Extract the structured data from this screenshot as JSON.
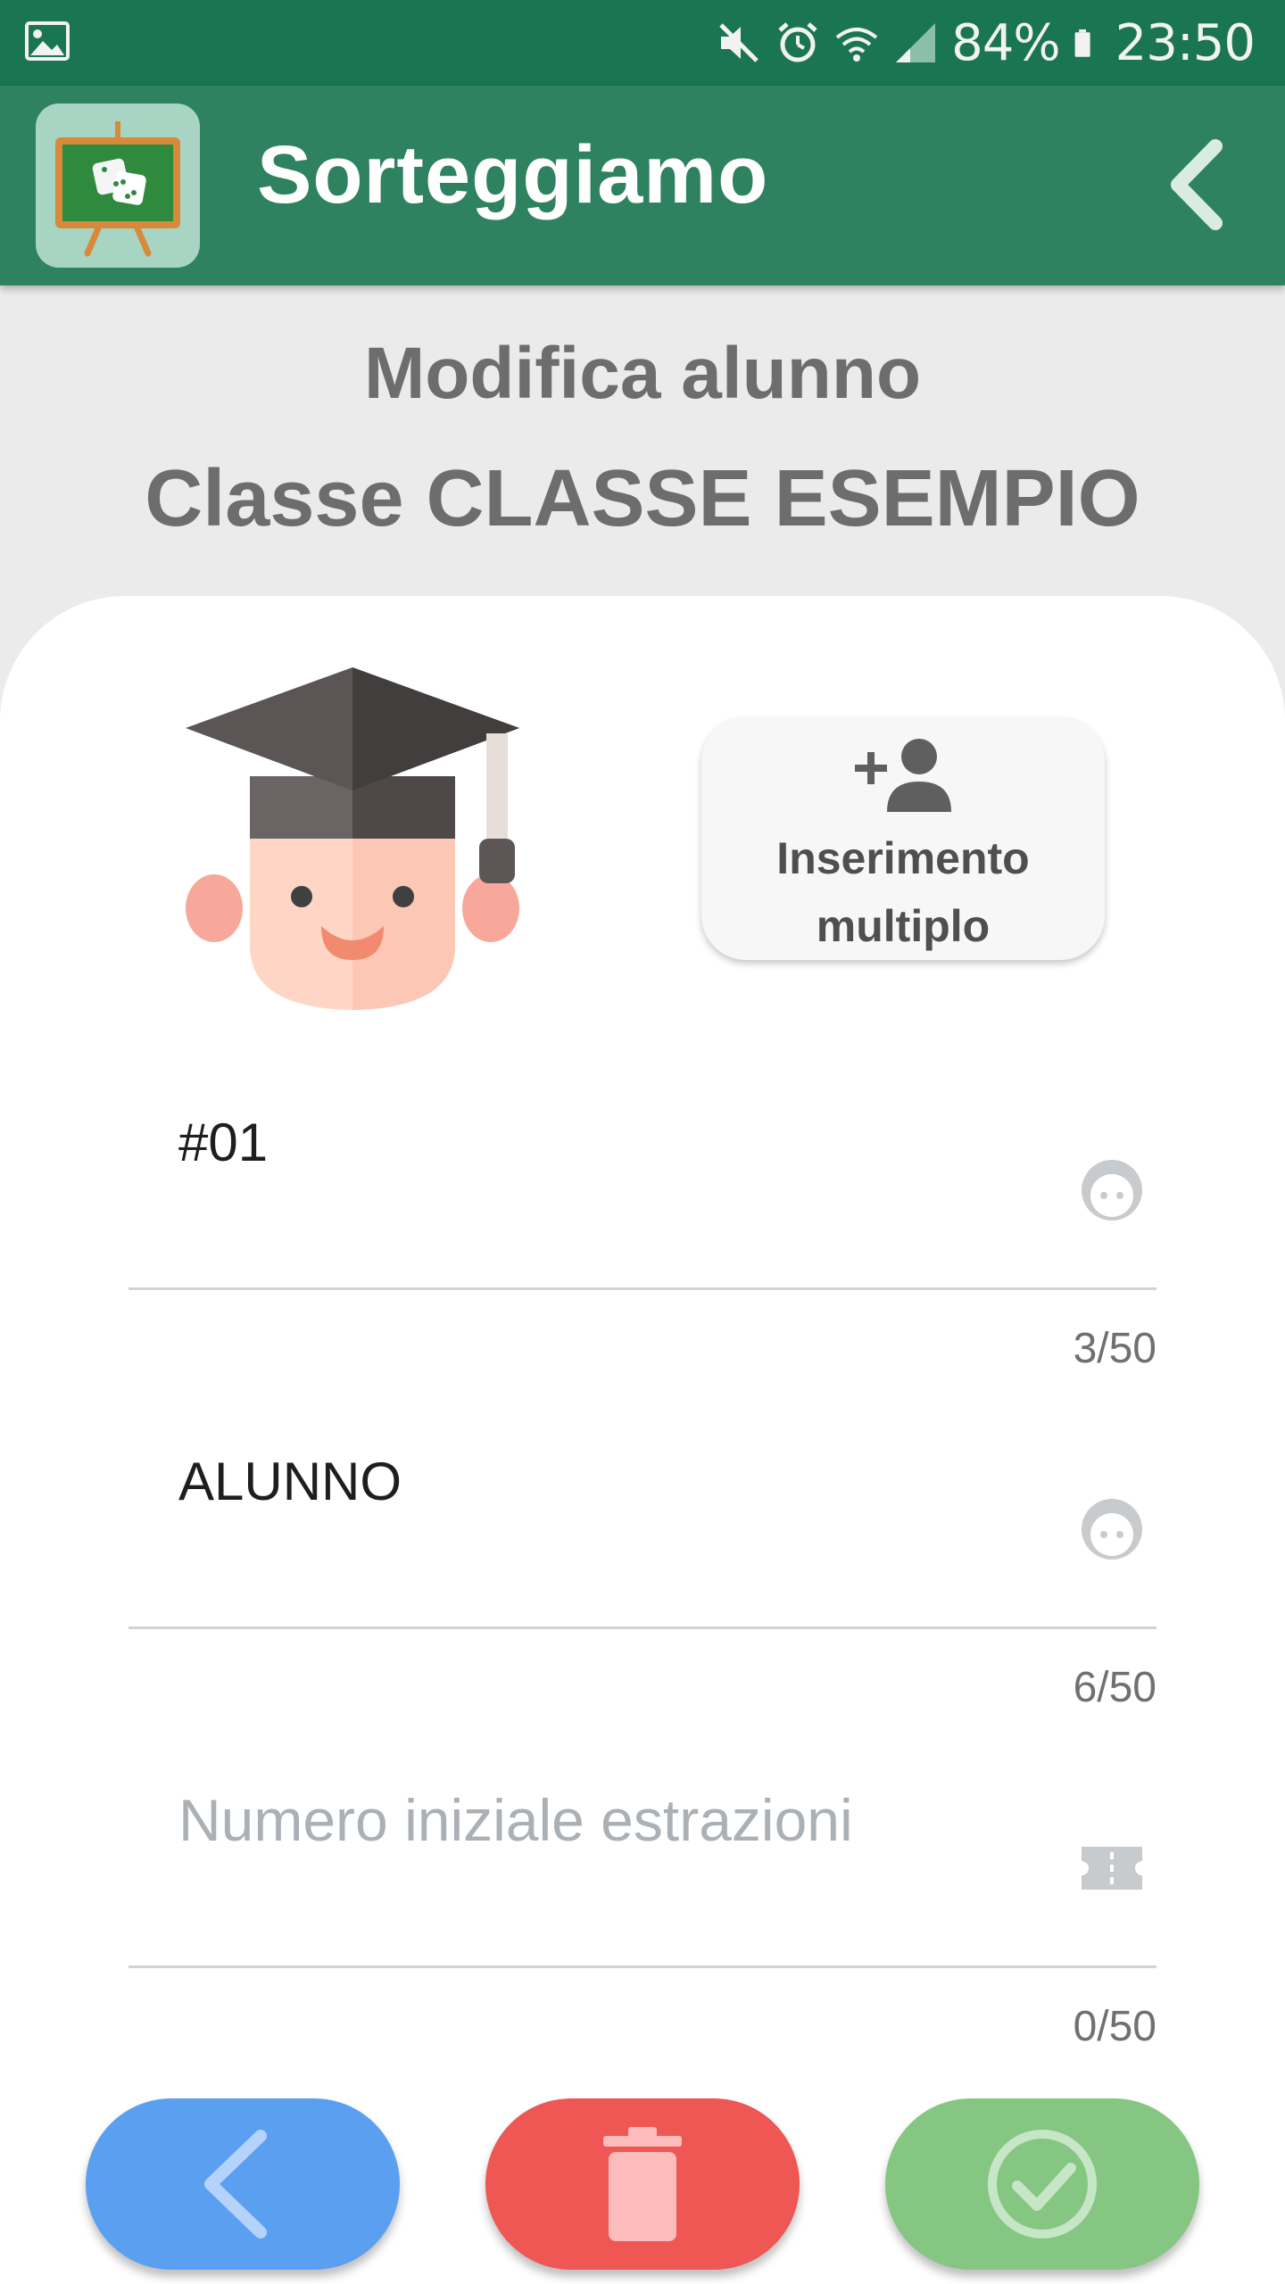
{
  "status_bar": {
    "battery": "84%",
    "time": "23:50",
    "icons": [
      "gallery-icon",
      "mute-icon",
      "alarm-icon",
      "wifi-icon",
      "signal-icon",
      "battery-icon"
    ]
  },
  "app_bar": {
    "title": "Sorteggiamo",
    "logo": "chalkboard-dice-logo",
    "back_icon": "chevron-left-icon"
  },
  "header": {
    "line1": "Modifica alunno",
    "line2": "Classe CLASSE ESEMPIO"
  },
  "multi_insert_button": {
    "label": "Inserimento\nmultiplo",
    "icon": "add-person-icon"
  },
  "fields": [
    {
      "value": "#01",
      "placeholder": "",
      "counter": "3/50",
      "icon": "face-icon"
    },
    {
      "value": "ALUNNO",
      "placeholder": "",
      "counter": "6/50",
      "icon": "face-icon"
    },
    {
      "value": "",
      "placeholder": "Numero iniziale estrazioni",
      "counter": "0/50",
      "icon": "ticket-icon"
    }
  ],
  "actions": {
    "back": "back-arrow-icon",
    "delete": "trash-icon",
    "confirm": "check-circle-icon"
  },
  "colors": {
    "status_bar": "#1a7553",
    "app_bar": "#2e8260",
    "back_button": "#5b9ff1",
    "delete_button": "#ee5753",
    "confirm_button": "#84c682"
  }
}
